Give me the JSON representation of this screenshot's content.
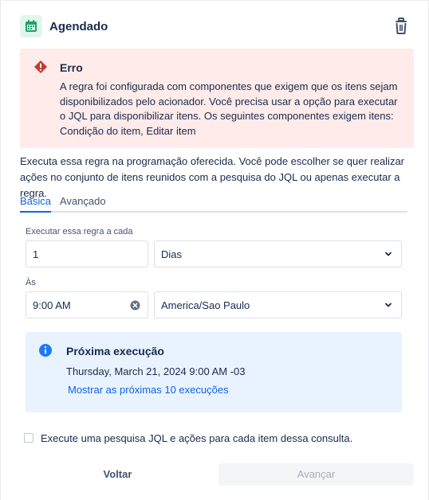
{
  "header": {
    "title": "Agendado",
    "icon": "calendar-icon",
    "delete_icon": "trash-icon"
  },
  "error": {
    "icon": "error-icon",
    "title": "Erro",
    "message": "A regra foi configurada com componentes que exigem que os itens sejam disponibilizados pelo acionador. Você precisa usar a opção para executar o JQL para disponibilizar itens. Os seguintes componentes exigem itens: Condição do item, Editar item"
  },
  "description": "Executa essa regra na programação oferecida. Você pode escolher se quer realizar ações no conjunto de itens reunidos com a pesquisa do JQL ou apenas executar a regra.",
  "tabs": [
    {
      "label": "Básica",
      "active": true
    },
    {
      "label": "Avançado",
      "active": false
    }
  ],
  "schedule": {
    "every_label": "Executar essa regra a cada",
    "interval_value": "1",
    "unit_value": "Dias",
    "at_label": "Às",
    "time_value": "9:00 AM",
    "timezone_value": "America/Sao Paulo"
  },
  "next_run": {
    "icon": "info-icon",
    "title": "Próxima execução",
    "date": "Thursday, March 21, 2024 9:00 AM -03",
    "link": "Mostrar as próximas 10 execuções"
  },
  "jql_option": {
    "label": "Execute uma pesquisa JQL e ações para cada item dessa consulta.",
    "checked": false
  },
  "footer": {
    "back_label": "Voltar",
    "next_label": "Avançar"
  },
  "colors": {
    "accent": "#0c66e4",
    "error_bg": "#ffebe9",
    "error_icon": "#c9372c",
    "info_bg": "#e9f2ff",
    "calendar_icon": "#22a06b"
  }
}
